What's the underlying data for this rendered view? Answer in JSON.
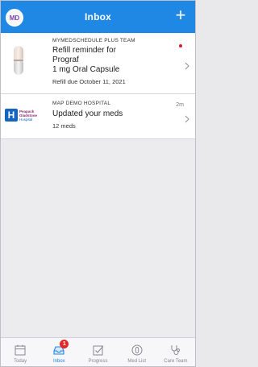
{
  "header": {
    "avatar_initials": "MD",
    "title": "Inbox",
    "compose_label": "+"
  },
  "messages": [
    {
      "sender": "MYMEDSCHEDULE PLUS TEAM",
      "title_line1": "Refill reminder for",
      "title_line2": "Prograf",
      "title_line3": "1 mg Oral Capsule",
      "subtitle": "Refill due October 11, 2021",
      "unread": true,
      "icon": "capsule-icon"
    },
    {
      "sender": "MAP DEMO HOSPITAL",
      "title": "Updated your meds",
      "subtitle": "12 meds",
      "time": "2m",
      "logo_letter": "H",
      "logo_text_line1": "Peapack",
      "logo_text_line2": "Gladstone",
      "logo_text_line3": "Hospital"
    }
  ],
  "tabs": [
    {
      "label": "Today",
      "icon": "calendar-icon"
    },
    {
      "label": "Inbox",
      "icon": "inbox-icon",
      "badge": "1",
      "active": true
    },
    {
      "label": "Progress",
      "icon": "checkbox-icon"
    },
    {
      "label": "Med List",
      "icon": "pill-bottle-icon"
    },
    {
      "label": "Care Team",
      "icon": "stethoscope-icon"
    }
  ],
  "colors": {
    "brand_blue": "#1f88e5",
    "badge_red": "#e12727",
    "logo_blue": "#1565c0"
  }
}
